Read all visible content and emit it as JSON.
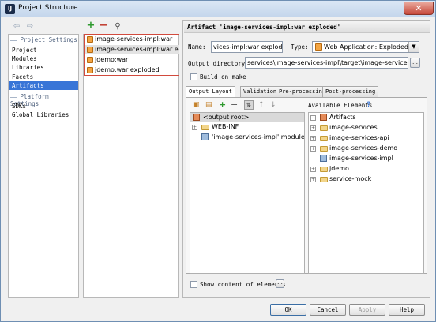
{
  "window": {
    "app_icon": "IJ",
    "title": "Project Structure"
  },
  "nav": {
    "project_settings_header": "Project Settings",
    "platform_settings_header": "Platform Settings",
    "project_items": [
      "Project",
      "Modules",
      "Libraries",
      "Facets",
      "Artifacts"
    ],
    "platform_items": [
      "SDKs",
      "Global Libraries"
    ],
    "selected": "Artifacts"
  },
  "artifacts": {
    "items": [
      "image-services-impl:war",
      "image-services-impl:war exploded",
      "jdemo:war",
      "jdemo:war exploded"
    ],
    "selected_index": 1
  },
  "detail": {
    "header": "Artifact 'image-services-impl:war exploded'",
    "name_label": "Name:",
    "name_value": "vices-impl:war exploded",
    "type_label": "Type:",
    "type_value": "Web Application: Exploded",
    "output_dir_label": "Output directory:",
    "output_dir_value": "services\\image-services-impl\\target\\image-services-impl",
    "build_on_make_label": "Build on make",
    "build_on_make_checked": false,
    "tabs": [
      "Output Layout",
      "Validation",
      "Pre-processing",
      "Post-processing"
    ],
    "active_tab": "Output Layout",
    "available_elements_label": "Available Elements",
    "help_mark": "?",
    "layout_tree": {
      "root": "<output root>",
      "children": [
        "WEB-INF",
        "'image-services-impl' module: 'W"
      ]
    },
    "available_tree": {
      "root": "Artifacts",
      "children": [
        "image-services",
        "image-services-api",
        "image-services-demo",
        "image-services-impl",
        "jdemo",
        "service-mock"
      ]
    },
    "show_content_label": "Show content of elements",
    "show_content_checked": false,
    "more_button": "..."
  },
  "buttons": {
    "ok": "OK",
    "cancel": "Cancel",
    "apply": "Apply",
    "help": "Help"
  },
  "colors": {
    "selection": "#3875d7",
    "highlight_border": "#d24a3d",
    "add_icon": "#2f9a2f",
    "remove_icon": "#c0392b"
  }
}
